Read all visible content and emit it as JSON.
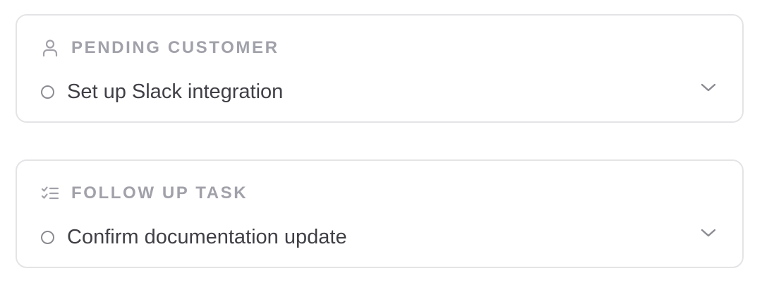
{
  "cards": [
    {
      "header_label": "PENDING CUSTOMER",
      "header_icon": "user-icon",
      "task_title": "Set up Slack integration",
      "status_icon": "circle-icon",
      "expand_icon": "chevron-down-icon"
    },
    {
      "header_label": "FOLLOW UP TASK",
      "header_icon": "checklist-icon",
      "task_title": "Confirm documentation update",
      "status_icon": "circle-icon",
      "expand_icon": "chevron-down-icon"
    }
  ],
  "colors": {
    "border": "#e4e4e7",
    "header_text": "#a1a1aa",
    "task_text": "#3f3f46",
    "icon": "#8b8b93"
  }
}
